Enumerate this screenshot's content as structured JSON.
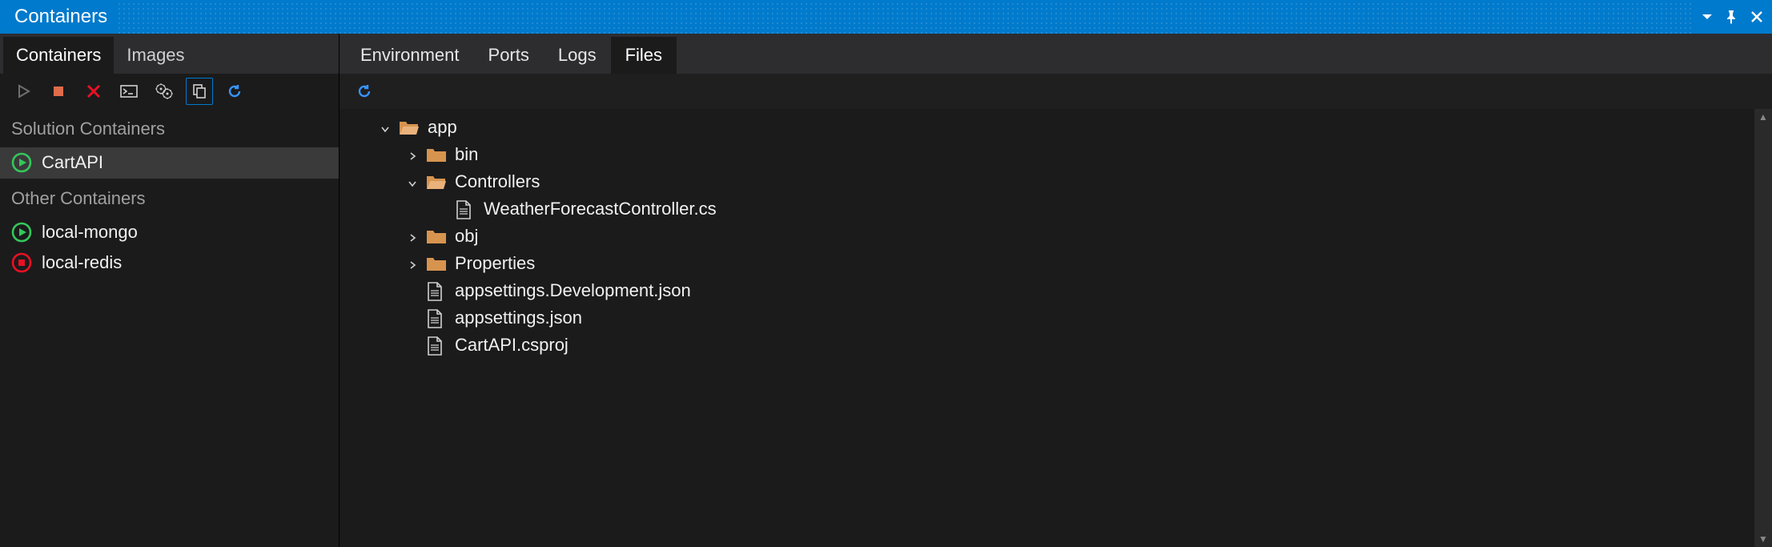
{
  "colors": {
    "accent": "#007acc",
    "green": "#34c759",
    "red": "#e81123",
    "orange": "#d7944f",
    "blue_refresh": "#3794ff"
  },
  "titlebar": {
    "title": "Containers"
  },
  "left": {
    "tabs": [
      {
        "label": "Containers",
        "active": true
      },
      {
        "label": "Images",
        "active": false
      }
    ],
    "groups": [
      {
        "header": "Solution Containers",
        "items": [
          {
            "name": "CartAPI",
            "status": "running",
            "selected": true
          }
        ]
      },
      {
        "header": "Other Containers",
        "items": [
          {
            "name": "local-mongo",
            "status": "running",
            "selected": false
          },
          {
            "name": "local-redis",
            "status": "stopped",
            "selected": false
          }
        ]
      }
    ]
  },
  "right": {
    "tabs": [
      {
        "label": "Environment",
        "active": false
      },
      {
        "label": "Ports",
        "active": false
      },
      {
        "label": "Logs",
        "active": false
      },
      {
        "label": "Files",
        "active": true
      }
    ],
    "tree": [
      {
        "depth": 1,
        "type": "folder-open",
        "arrow": "down",
        "label": "app"
      },
      {
        "depth": 2,
        "type": "folder-closed",
        "arrow": "right",
        "label": "bin"
      },
      {
        "depth": 2,
        "type": "folder-open",
        "arrow": "down",
        "label": "Controllers"
      },
      {
        "depth": 3,
        "type": "file",
        "arrow": "none",
        "label": "WeatherForecastController.cs"
      },
      {
        "depth": 2,
        "type": "folder-closed",
        "arrow": "right",
        "label": "obj"
      },
      {
        "depth": 2,
        "type": "folder-closed",
        "arrow": "right",
        "label": "Properties"
      },
      {
        "depth": 2,
        "type": "file",
        "arrow": "none",
        "label": "appsettings.Development.json"
      },
      {
        "depth": 2,
        "type": "file",
        "arrow": "none",
        "label": "appsettings.json"
      },
      {
        "depth": 2,
        "type": "file",
        "arrow": "none",
        "label": "CartAPI.csproj"
      }
    ]
  }
}
